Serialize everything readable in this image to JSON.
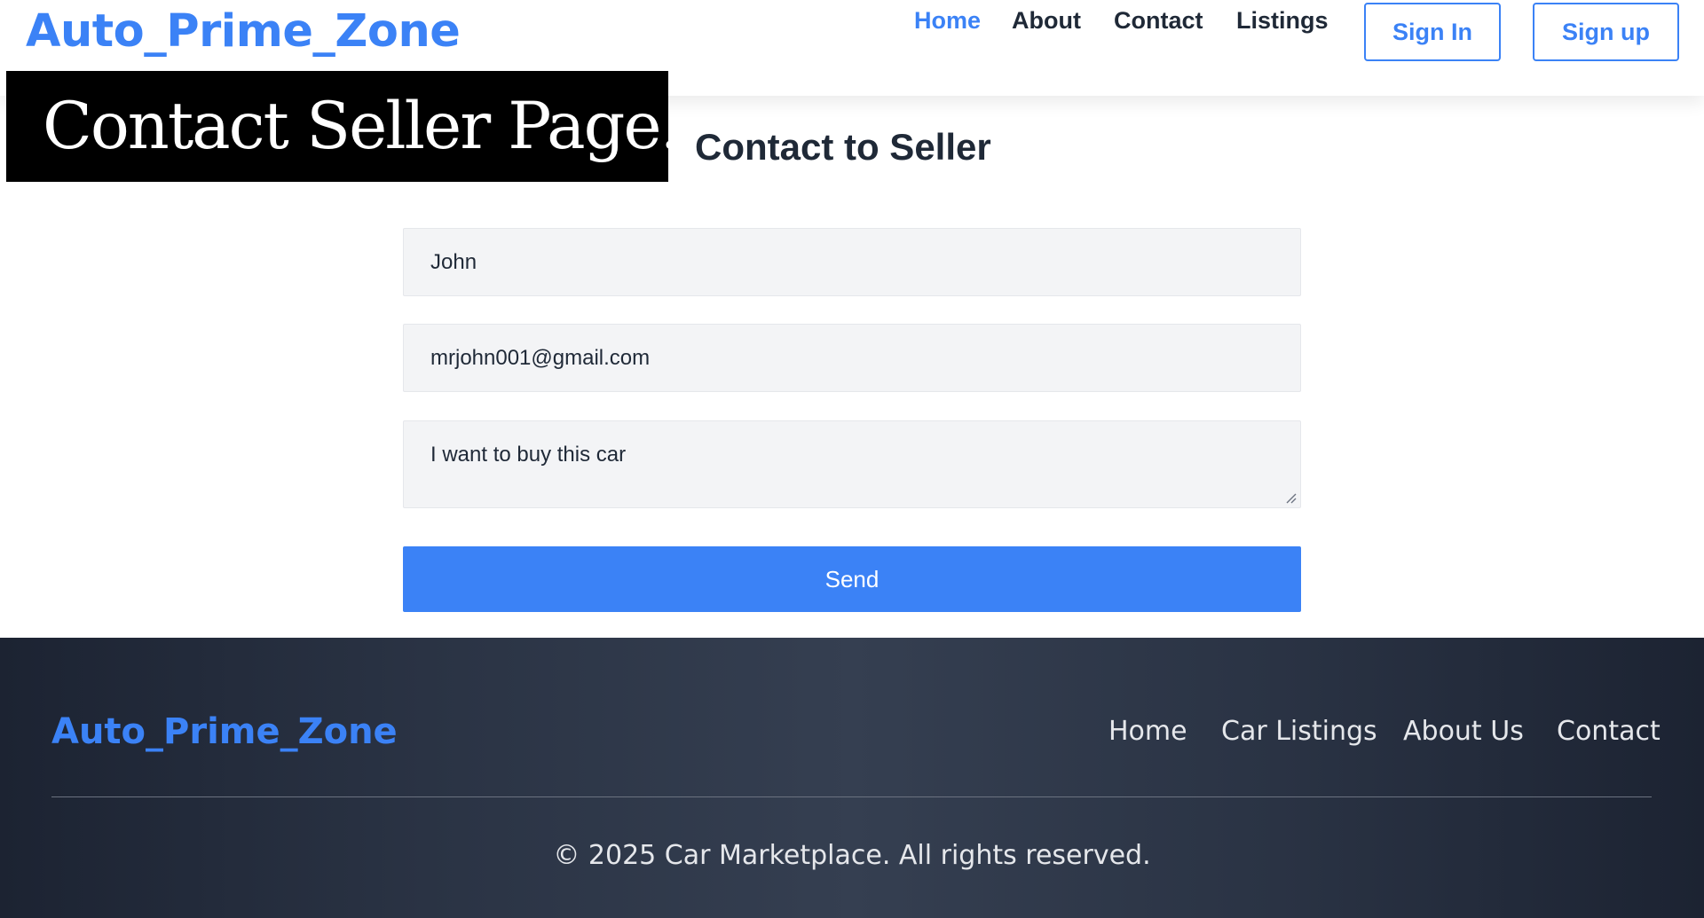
{
  "header": {
    "brand": "Auto_Prime_Zone",
    "nav": [
      {
        "label": "Home",
        "active": true
      },
      {
        "label": "About",
        "active": false
      },
      {
        "label": "Contact",
        "active": false
      },
      {
        "label": "Listings",
        "active": false
      }
    ],
    "sign_in": "Sign In",
    "sign_up": "Sign up"
  },
  "overlay_caption": "Contact Seller Page.",
  "main": {
    "title": "Contact to Seller",
    "form": {
      "name_value": "John",
      "email_value": "mrjohn001@gmail.com",
      "message_value": "I want to buy this car",
      "send_label": "Send"
    }
  },
  "footer": {
    "brand": "Auto_Prime_Zone",
    "links": [
      "Home",
      "Car Listings",
      "About Us",
      "Contact"
    ],
    "copyright": "© 2025 Car Marketplace. All rights reserved."
  },
  "colors": {
    "accent": "#3b82f6",
    "text_dark": "#1f2937",
    "field_bg": "#f3f4f6",
    "footer_bg": "#2a3344"
  }
}
